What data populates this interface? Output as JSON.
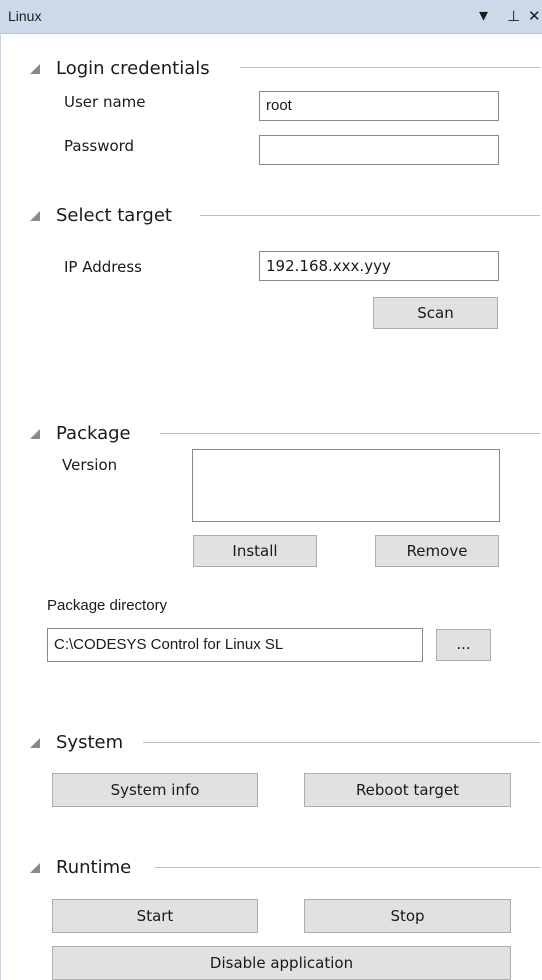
{
  "window": {
    "title": "Linux",
    "controls": {
      "dropdown": "▾",
      "pin": "⊥",
      "close": "✕"
    }
  },
  "login": {
    "section_title": "Login credentials",
    "username_label": "User name",
    "username_value": "root",
    "password_label": "Password",
    "password_value": ""
  },
  "target": {
    "section_title": "Select target",
    "ip_label": "IP Address",
    "ip_value": "192.168.xxx.yyy",
    "scan_label": "Scan"
  },
  "package": {
    "section_title": "Package",
    "version_label": "Version",
    "version_value": "",
    "install_label": "Install",
    "remove_label": "Remove",
    "directory_label": "Package directory",
    "directory_value": "C:\\CODESYS Control for Linux SL",
    "browse_label": "..."
  },
  "system": {
    "section_title": "System",
    "info_label": "System info",
    "reboot_label": "Reboot target"
  },
  "runtime": {
    "section_title": "Runtime",
    "start_label": "Start",
    "stop_label": "Stop",
    "disable_label": "Disable application"
  }
}
